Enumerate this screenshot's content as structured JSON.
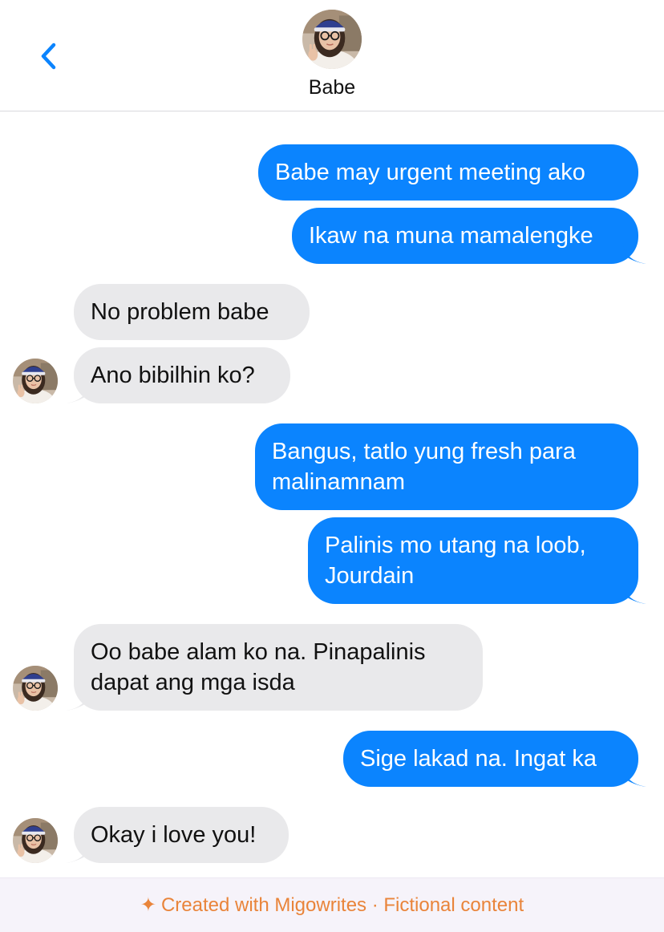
{
  "header": {
    "contact_name": "Babe",
    "back_icon": "chevron-left-icon"
  },
  "colors": {
    "sent_bubble": "#0b84fe",
    "received_bubble": "#e9e9eb",
    "accent": "#0b84fe",
    "footer_text": "#e9843a"
  },
  "messages": [
    {
      "side": "sent",
      "text": "Babe may urgent meeting ako"
    },
    {
      "side": "sent",
      "text": "Ikaw na muna mamalengke"
    },
    {
      "side": "received",
      "text": "No problem babe"
    },
    {
      "side": "received",
      "text": "Ano bibilhin ko?"
    },
    {
      "side": "sent",
      "text": "Bangus, tatlo yung fresh para malinamnam"
    },
    {
      "side": "sent",
      "text": "Palinis mo utang na loob, Jourdain"
    },
    {
      "side": "received",
      "text": "Oo babe alam ko na. Pinapalinis dapat ang mga isda"
    },
    {
      "side": "sent",
      "text": "Sige lakad na. Ingat ka"
    },
    {
      "side": "received",
      "text": "Okay i love you!"
    }
  ],
  "footer": {
    "star": "✦",
    "text": "Created with Migowrites · Fictional content"
  }
}
